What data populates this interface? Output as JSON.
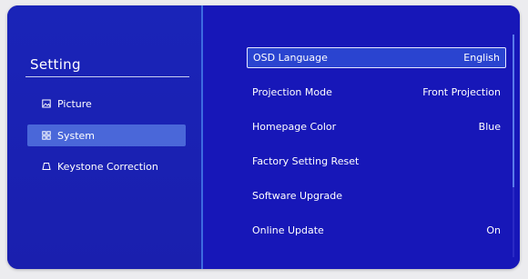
{
  "sidebar": {
    "title": "Setting",
    "items": [
      {
        "label": "Picture",
        "icon": "picture-icon",
        "active": false
      },
      {
        "label": "System",
        "icon": "system-icon",
        "active": true
      },
      {
        "label": "Keystone Correction",
        "icon": "keystone-icon",
        "active": false
      }
    ]
  },
  "menu": {
    "rows": [
      {
        "label": "OSD Language",
        "value": "English",
        "focused": true
      },
      {
        "label": "Projection Mode",
        "value": "Front Projection",
        "focused": false
      },
      {
        "label": "Homepage Color",
        "value": "Blue",
        "focused": false
      },
      {
        "label": "Factory Setting Reset",
        "value": "",
        "focused": false
      },
      {
        "label": "Software Upgrade",
        "value": "",
        "focused": false
      },
      {
        "label": "Online Update",
        "value": "On",
        "focused": false
      }
    ]
  },
  "colors": {
    "background": "#1717b8",
    "highlight": "#4a67d9",
    "divider": "#3d6be0"
  }
}
